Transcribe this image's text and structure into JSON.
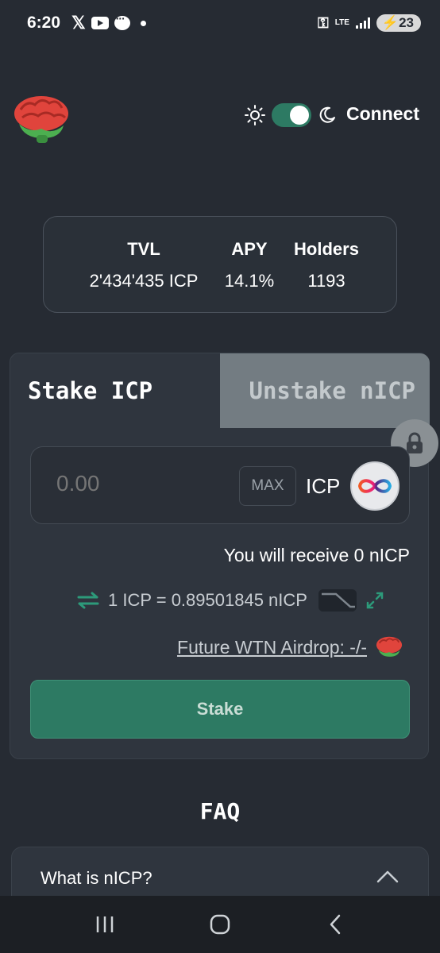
{
  "status_bar": {
    "time": "6:20",
    "lte": "LTE",
    "battery": "23"
  },
  "header": {
    "logo_icon": "brain-icon",
    "connect_label": "Connect",
    "theme_toggle_on": true
  },
  "stats": {
    "tvl_label": "TVL",
    "tvl_value": "2'434'435 ICP",
    "apy_label": "APY",
    "apy_value": "14.1%",
    "holders_label": "Holders",
    "holders_value": "1193"
  },
  "stake_panel": {
    "tab_stake": "Stake ICP",
    "tab_unstake": "Unstake nICP",
    "amount_placeholder": "0.00",
    "max_label": "MAX",
    "currency": "ICP",
    "receive_text": "You will receive 0 nICP",
    "rate_text": "1 ICP = 0.89501845 nICP",
    "airdrop_text": "Future WTN Airdrop: -/-",
    "stake_button": "Stake"
  },
  "faq": {
    "title": "FAQ",
    "items": [
      {
        "question": "What is nICP?"
      }
    ]
  },
  "colors": {
    "background": "#262b33",
    "accent": "#2d7a63",
    "panel": "#2f353e"
  }
}
